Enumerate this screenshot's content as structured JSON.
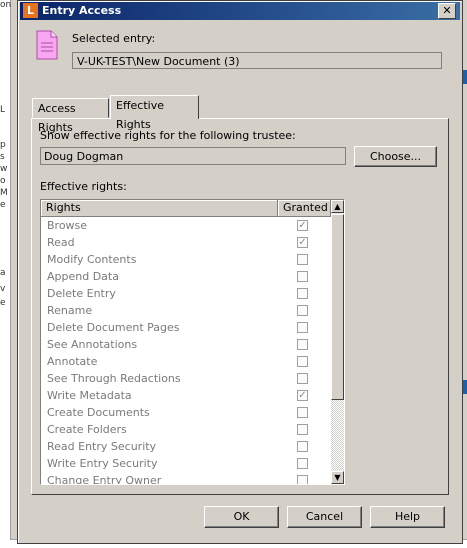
{
  "window": {
    "title": "Entry Access",
    "app_icon_letter": "L",
    "close_glyph": "✕"
  },
  "entry": {
    "selected_label": "Selected entry:",
    "path": "V-UK-TEST\\New Document (3)"
  },
  "tabs": [
    {
      "label": "Access Rights",
      "active": false
    },
    {
      "label": "Effective Rights",
      "active": true
    }
  ],
  "trustee": {
    "label": "Show effective rights for the following trustee:",
    "value": "Doug Dogman",
    "choose_label": "Choose..."
  },
  "rights": {
    "label": "Effective rights:",
    "columns": [
      "Rights",
      "Granted"
    ],
    "items": [
      {
        "name": "Browse",
        "granted": true
      },
      {
        "name": "Read",
        "granted": true
      },
      {
        "name": "Modify Contents",
        "granted": false
      },
      {
        "name": "Append Data",
        "granted": false
      },
      {
        "name": "Delete Entry",
        "granted": false
      },
      {
        "name": "Rename",
        "granted": false
      },
      {
        "name": "Delete Document Pages",
        "granted": false
      },
      {
        "name": "See Annotations",
        "granted": false
      },
      {
        "name": "Annotate",
        "granted": false
      },
      {
        "name": "See Through Redactions",
        "granted": false
      },
      {
        "name": "Write Metadata",
        "granted": true
      },
      {
        "name": "Create Documents",
        "granted": false
      },
      {
        "name": "Create Folders",
        "granted": false
      },
      {
        "name": "Read Entry Security",
        "granted": false
      },
      {
        "name": "Write Entry Security",
        "granted": false
      },
      {
        "name": "Change Entry Owner",
        "granted": false
      }
    ]
  },
  "buttons": {
    "ok": "OK",
    "cancel": "Cancel",
    "help": "Help"
  },
  "background_fragments": [
    "on",
    "L",
    "p",
    "s",
    "w",
    "o",
    "M",
    "e",
    "a",
    "v",
    "e"
  ],
  "colors": {
    "titlebar_start": "#0a246a",
    "titlebar_end": "#3a6ea5",
    "app_icon": "#e8731d",
    "doc_icon": "#f7a6f0"
  }
}
